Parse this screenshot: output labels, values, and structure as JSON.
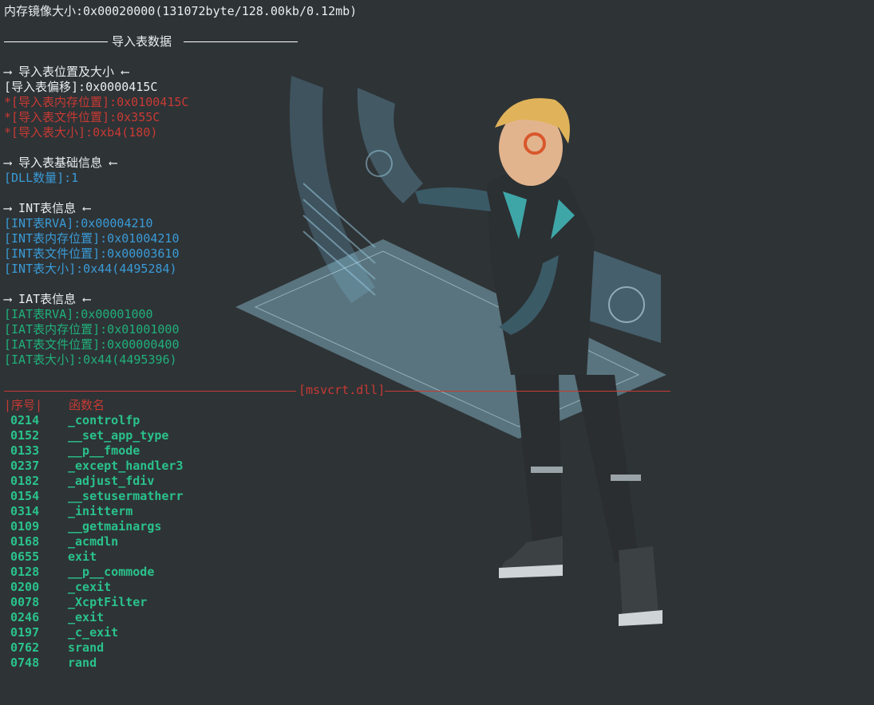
{
  "image_size_line": "内存镜像大小:0x00020000(131072byte/128.00kb/0.12mb)",
  "import_section_title": "导入表数据",
  "location_header": "⟶ 导入表位置及大小 ⟵",
  "import_offset": "[导入表偏移]:0x0000415C",
  "import_mem_pos": "*[导入表内存位置]:0x0100415C",
  "import_file_pos": "*[导入表文件位置]:0x355C",
  "import_size": "*[导入表大小]:0xb4(180)",
  "basic_info_header": "⟶ 导入表基础信息 ⟵",
  "dll_count": "[DLL数量]:1",
  "int_header": "⟶ INT表信息 ⟵",
  "int_rva": "[INT表RVA]:0x00004210",
  "int_mem_pos": "[INT表内存位置]:0x01004210",
  "int_file_pos": "[INT表文件位置]:0x00003610",
  "int_size": "[INT表大小]:0x44(4495284)",
  "iat_header": "⟶ IAT表信息 ⟵",
  "iat_rva": "[IAT表RVA]:0x00001000",
  "iat_mem_pos": "[IAT表内存位置]:0x01001000",
  "iat_file_pos": "[IAT表文件位置]:0x00000400",
  "iat_size": "[IAT表大小]:0x44(4495396)",
  "dll_name": "[msvcrt.dll]",
  "table_header": {
    "ordinal": "|序号|",
    "function": "函数名"
  },
  "functions": [
    {
      "ordinal": "0214",
      "name": "_controlfp"
    },
    {
      "ordinal": "0152",
      "name": "__set_app_type"
    },
    {
      "ordinal": "0133",
      "name": "__p__fmode"
    },
    {
      "ordinal": "0237",
      "name": "_except_handler3"
    },
    {
      "ordinal": "0182",
      "name": "_adjust_fdiv"
    },
    {
      "ordinal": "0154",
      "name": "__setusermatherr"
    },
    {
      "ordinal": "0314",
      "name": "_initterm"
    },
    {
      "ordinal": "0109",
      "name": "__getmainargs"
    },
    {
      "ordinal": "0168",
      "name": "_acmdln"
    },
    {
      "ordinal": "0655",
      "name": "exit"
    },
    {
      "ordinal": "0128",
      "name": "__p__commode"
    },
    {
      "ordinal": "0200",
      "name": "_cexit"
    },
    {
      "ordinal": "0078",
      "name": "_XcptFilter"
    },
    {
      "ordinal": "0246",
      "name": "_exit"
    },
    {
      "ordinal": "0197",
      "name": "_c_exit"
    },
    {
      "ordinal": "0762",
      "name": "srand"
    },
    {
      "ordinal": "0748",
      "name": "rand"
    }
  ],
  "colors": {
    "background": "#2e3336",
    "text": "#e9eef1",
    "red": "#c83a33",
    "blue": "#3a9bd6",
    "green": "#20b07a"
  }
}
